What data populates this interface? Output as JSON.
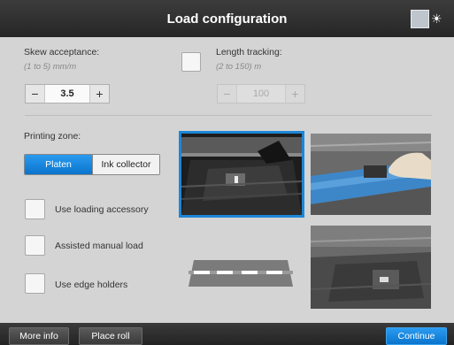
{
  "header": {
    "title": "Load configuration",
    "brightness_icon": "sun-icon"
  },
  "skew": {
    "label": "Skew acceptance:",
    "range": "(1 to 5) mm/m",
    "value": "3.5",
    "minus": "−",
    "plus": "+"
  },
  "length_tracking": {
    "label": "Length tracking:",
    "range": "(2 to 150) m",
    "value": "100",
    "minus": "−",
    "plus": "+",
    "enabled": false
  },
  "printing_zone": {
    "label": "Printing zone:",
    "options": [
      "Platen",
      "Ink collector"
    ],
    "selected": "Platen"
  },
  "options": [
    {
      "label": "Use loading accessory",
      "checked": false
    },
    {
      "label": "Assisted manual load",
      "checked": false
    },
    {
      "label": "Use edge holders",
      "checked": false
    }
  ],
  "footer": {
    "more_info": "More info",
    "place_roll": "Place roll",
    "continue": "Continue"
  },
  "colors": {
    "accent": "#0a74cc",
    "titlebar": "#2e2e2e",
    "background": "#d4d4d4"
  }
}
